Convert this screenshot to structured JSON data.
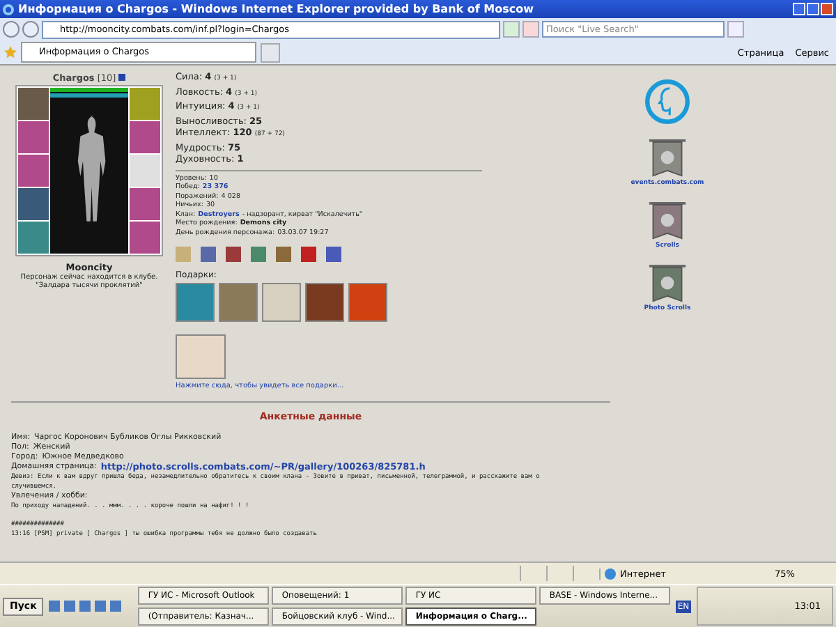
{
  "window": {
    "title": "Информация о Chargos - Windows Internet Explorer provided by Bank of Moscow"
  },
  "address_bar": {
    "url": "http://mooncity.combats.com/inf.pl?login=Chargos"
  },
  "search": {
    "placeholder": "Поиск \"Live Search\""
  },
  "tabs": [
    {
      "label": "Информация о Chargos",
      "selected": true
    }
  ],
  "toolbar": [
    {
      "label": "Страница"
    },
    {
      "label": "Сервис"
    }
  ],
  "character": {
    "name": "Chargos",
    "level_text": "[10]",
    "bars": [
      {
        "kind": "hp",
        "level": 1
      },
      {
        "kind": "mana",
        "level": 1
      }
    ],
    "city": "Mooncity",
    "location": "Персонаж сейчас находится в клубе.",
    "room": "\"Залдара тысячи проклятий\""
  },
  "stats": [
    {
      "label": "Сила:",
      "value": "4",
      "extra": "(3 + 1)"
    },
    {
      "label": "Ловкость:",
      "value": "4",
      "extra": "(3 + 1)"
    },
    {
      "label": "Интуиция:",
      "value": "4",
      "extra": "(3 + 1)"
    },
    {
      "label": "Выносливость:",
      "value": "25"
    },
    {
      "label": "Интеллект:",
      "value": "120",
      "extra": "(87 + 72)"
    },
    {
      "label": "Мудрость:",
      "value": "75"
    },
    {
      "label": "Духовность:",
      "value": "1"
    }
  ],
  "info": [
    {
      "label": "Уровень:",
      "value": "10",
      "kind": "plain"
    },
    {
      "label": "Побед:",
      "value": "23 376",
      "kind": "link"
    },
    {
      "label": "Поражений:",
      "value": "4 028",
      "kind": "plain"
    },
    {
      "label": "Ничьих:",
      "value": "30",
      "kind": "plain"
    },
    {
      "label": "Клан:",
      "value": "Destroyers",
      "kind": "link",
      "suffix": "- надзорант, кирват \"Искалечить\""
    },
    {
      "label": "Место рождения:",
      "value": "Demons city",
      "kind": "bold"
    },
    {
      "label": "День рождения персонажа:",
      "value": "03.03.07 19:27",
      "kind": "plain"
    }
  ],
  "gifts": {
    "label": "Подарки:",
    "link": "Нажмите сюда, чтобы увидеть все подарки..."
  },
  "sidebar_links": [
    {
      "caption": "events.combats.com"
    },
    {
      "caption": "Scrolls"
    },
    {
      "caption": "Photo Scrolls"
    }
  ],
  "profile": {
    "title": "Анкетные данные",
    "fields": [
      {
        "label": "Имя:",
        "value": "Чаргос Коронович Бубликов Оглы Рикковский",
        "kind": "plain"
      },
      {
        "label": "Пол:",
        "value": "Женский",
        "kind": "plain"
      },
      {
        "label": "Город:",
        "value": "Южное Медведково",
        "kind": "plain"
      },
      {
        "label": "Домашняя страница:",
        "value": "http://photo.scrolls.combats.com/~PR/gallery/100263/825781.h",
        "kind": "link"
      },
      {
        "label": "Девиз:",
        "value": "Если к вам вдруг пришла беда, незамедлительно обратитесь к своим клана - Зовите в приват, письменной, телеграммой, и расскажите вам о случившемся.",
        "kind": "mono"
      },
      {
        "label": "Увлечения / хобби:",
        "kind": "heading"
      }
    ],
    "hobby_lines": [
      "По приходу нападений. . . ммм. . . . короче пошли на нафиг! ! !"
    ],
    "log_lines": [
      "##############",
      "13:16 [PSM] private [ Chargos ] ты ошибка программы тебя не должно было создавать"
    ]
  },
  "status_bar": {
    "zone": "Интернет",
    "zoom": "75%"
  },
  "taskbar": {
    "start": "Пуск",
    "tasks": [
      {
        "label": "ГУ ИС - Microsoft Outlook",
        "selected": false
      },
      {
        "label": "Оповещений: 1",
        "selected": false
      },
      {
        "label": "ГУ ИС",
        "selected": false
      },
      {
        "label": "BASE - Windows Interne...",
        "selected": false
      },
      {
        "label": "(Отправитель: Казнач...",
        "selected": false
      },
      {
        "label": "Бойцовский клуб - Wind...",
        "selected": false
      },
      {
        "label": "Информация о Charg...",
        "selected": true
      }
    ],
    "lang": "EN",
    "clock": "13:01"
  }
}
